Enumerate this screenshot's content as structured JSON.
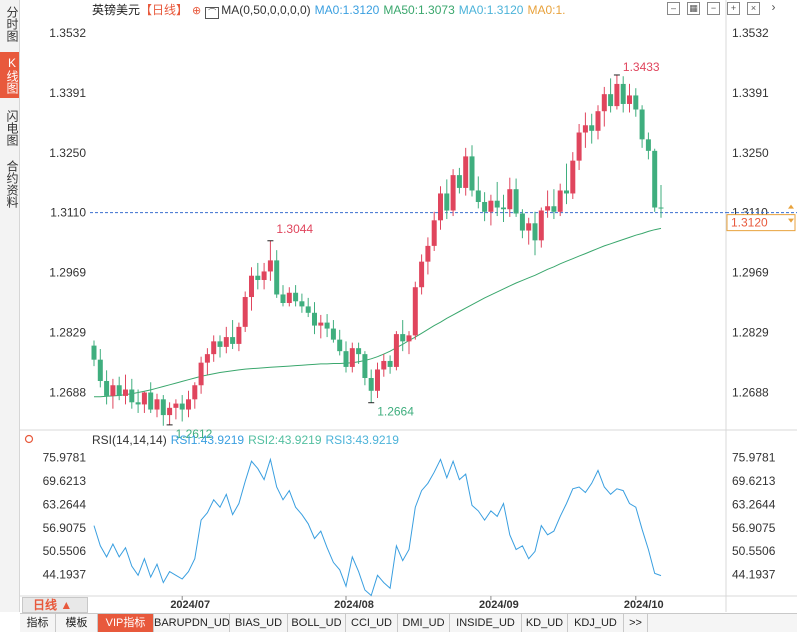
{
  "sidebar": {
    "tabs": [
      {
        "label": "分时图",
        "active": false
      },
      {
        "label": "K线图",
        "active": true
      },
      {
        "label": "闪电图",
        "active": false
      },
      {
        "label": "合约资料",
        "active": false
      }
    ]
  },
  "header": {
    "symbol": "英镑美元",
    "period": "【日线】",
    "ma_label": "MA(0,50,0,0,0,0)",
    "ma_values": [
      "MA0:1.3120",
      "MA50:1.3073",
      "MA0:1.3120",
      "MA0:1."
    ]
  },
  "rsi_header": {
    "label": "RSI(14,14,14)",
    "values": [
      "RSI1:43.9219",
      "RSI2:43.9219",
      "RSI3:43.9219"
    ]
  },
  "price_panel": {
    "current_price": "1.3120",
    "current_price_partial": "1.3110",
    "high_annotation": "1.3433",
    "mid_high_annotation": "1.3044",
    "low_annotation_1": "1.2612",
    "low_annotation_2": "1.2664"
  },
  "bottom": {
    "period_button": "日线 ▲",
    "tabs": [
      "指标",
      "模板",
      "VIP指标",
      "BARUPDN_UD",
      "BIAS_UD",
      "BOLL_UD",
      "CCI_UD",
      "DMI_UD",
      "INSIDE_UD",
      "KD_UD",
      "KDJ_UD",
      ">>"
    ]
  },
  "colors": {
    "up": "#e0455d",
    "down": "#3fae7e",
    "ma50": "#3aa76d",
    "rsi": "#3a9fe0",
    "current_line": "#3a6fcf",
    "accent": "#e8593c"
  },
  "chart_data": [
    {
      "type": "candlestick",
      "title": "英镑美元 日线",
      "x_ticks": [
        "2024/07",
        "2024/08",
        "2024/09",
        "2024/10"
      ],
      "y_ticks": [
        1.3532,
        1.3391,
        1.325,
        1.311,
        1.2969,
        1.2829,
        1.2688
      ],
      "y_tick_labels": [
        "1.3532",
        "1.3391",
        "1.3250",
        "1.3110",
        "1.2969",
        "1.2829",
        "1.2688"
      ],
      "ylim": [
        1.26,
        1.3562
      ],
      "grid": false,
      "candles": [
        [
          1.2798,
          1.281,
          1.275,
          1.2765
        ],
        [
          1.2765,
          1.279,
          1.27,
          1.2715
        ],
        [
          1.2715,
          1.274,
          1.266,
          1.268
        ],
        [
          1.268,
          1.272,
          1.265,
          1.2705
        ],
        [
          1.2705,
          1.2725,
          1.267,
          1.268
        ],
        [
          1.268,
          1.273,
          1.266,
          1.2695
        ],
        [
          1.2695,
          1.272,
          1.265,
          1.2665
        ],
        [
          1.2665,
          1.2695,
          1.264,
          1.266
        ],
        [
          1.266,
          1.269,
          1.264,
          1.2688
        ],
        [
          1.2688,
          1.2712,
          1.264,
          1.2648
        ],
        [
          1.2648,
          1.2685,
          1.263,
          1.2672
        ],
        [
          1.2672,
          1.2682,
          1.261,
          1.2635
        ],
        [
          1.2635,
          1.2665,
          1.2612,
          1.2652
        ],
        [
          1.2652,
          1.2672,
          1.2625,
          1.2662
        ],
        [
          1.2662,
          1.2682,
          1.262,
          1.2648
        ],
        [
          1.2648,
          1.2692,
          1.263,
          1.2672
        ],
        [
          1.2672,
          1.2712,
          1.265,
          1.2705
        ],
        [
          1.2705,
          1.2772,
          1.2685,
          1.2758
        ],
        [
          1.2758,
          1.2792,
          1.273,
          1.2778
        ],
        [
          1.2778,
          1.2822,
          1.276,
          1.2808
        ],
        [
          1.2808,
          1.2822,
          1.277,
          1.2795
        ],
        [
          1.2795,
          1.2842,
          1.278,
          1.2818
        ],
        [
          1.2818,
          1.2858,
          1.279,
          1.2802
        ],
        [
          1.2802,
          1.2852,
          1.2785,
          1.2842
        ],
        [
          1.2842,
          1.2925,
          1.283,
          1.2912
        ],
        [
          1.2912,
          1.2982,
          1.288,
          1.2962
        ],
        [
          1.2962,
          1.2992,
          1.293,
          1.2952
        ],
        [
          1.2952,
          1.2992,
          1.293,
          1.2972
        ],
        [
          1.2972,
          1.3044,
          1.295,
          1.2998
        ],
        [
          1.2998,
          1.3022,
          1.291,
          1.2918
        ],
        [
          1.2918,
          1.294,
          1.289,
          1.2898
        ],
        [
          1.2898,
          1.2935,
          1.289,
          1.2922
        ],
        [
          1.2922,
          1.294,
          1.289,
          1.2902
        ],
        [
          1.2902,
          1.292,
          1.2875,
          1.289
        ],
        [
          1.289,
          1.291,
          1.2865,
          1.2875
        ],
        [
          1.2875,
          1.29,
          1.2825,
          1.2845
        ],
        [
          1.2845,
          1.287,
          1.2815,
          1.2852
        ],
        [
          1.2852,
          1.2872,
          1.2818,
          1.2838
        ],
        [
          1.2838,
          1.2858,
          1.2805,
          1.2812
        ],
        [
          1.2812,
          1.2835,
          1.2775,
          1.2785
        ],
        [
          1.2785,
          1.2808,
          1.2735,
          1.2748
        ],
        [
          1.2748,
          1.2805,
          1.2735,
          1.2792
        ],
        [
          1.2792,
          1.2805,
          1.2755,
          1.2778
        ],
        [
          1.2778,
          1.2785,
          1.2705,
          1.2722
        ],
        [
          1.2722,
          1.2742,
          1.2664,
          1.2692
        ],
        [
          1.2692,
          1.2758,
          1.2675,
          1.2742
        ],
        [
          1.2742,
          1.2778,
          1.2725,
          1.2762
        ],
        [
          1.2762,
          1.2775,
          1.2732,
          1.2748
        ],
        [
          1.2748,
          1.2832,
          1.274,
          1.2825
        ],
        [
          1.2825,
          1.2858,
          1.2785,
          1.2808
        ],
        [
          1.2808,
          1.2832,
          1.2778,
          1.2822
        ],
        [
          1.2822,
          1.2948,
          1.2812,
          1.2935
        ],
        [
          1.2935,
          1.3012,
          1.2918,
          1.2995
        ],
        [
          1.2995,
          1.3052,
          1.2965,
          1.3032
        ],
        [
          1.3032,
          1.3112,
          1.302,
          1.3092
        ],
        [
          1.3092,
          1.3172,
          1.307,
          1.3155
        ],
        [
          1.3155,
          1.3188,
          1.3095,
          1.3115
        ],
        [
          1.3115,
          1.3212,
          1.3102,
          1.3198
        ],
        [
          1.3198,
          1.3215,
          1.3155,
          1.3168
        ],
        [
          1.3168,
          1.3262,
          1.315,
          1.3242
        ],
        [
          1.3242,
          1.3268,
          1.3148,
          1.3162
        ],
        [
          1.3162,
          1.3195,
          1.312,
          1.3135
        ],
        [
          1.3135,
          1.3158,
          1.309,
          1.3112
        ],
        [
          1.3112,
          1.3152,
          1.308,
          1.3138
        ],
        [
          1.3138,
          1.3182,
          1.3102,
          1.3122
        ],
        [
          1.3122,
          1.3152,
          1.3088,
          1.3118
        ],
        [
          1.3118,
          1.3192,
          1.31,
          1.3165
        ],
        [
          1.3165,
          1.319,
          1.31,
          1.3108
        ],
        [
          1.3108,
          1.3118,
          1.305,
          1.3068
        ],
        [
          1.3068,
          1.3098,
          1.3035,
          1.3085
        ],
        [
          1.3085,
          1.3112,
          1.301,
          1.3045
        ],
        [
          1.3045,
          1.3122,
          1.3028,
          1.3115
        ],
        [
          1.3115,
          1.3162,
          1.3098,
          1.3125
        ],
        [
          1.3125,
          1.3165,
          1.3095,
          1.3112
        ],
        [
          1.3112,
          1.3178,
          1.3102,
          1.3162
        ],
        [
          1.3162,
          1.3225,
          1.313,
          1.3155
        ],
        [
          1.3155,
          1.3252,
          1.3142,
          1.3232
        ],
        [
          1.3232,
          1.3318,
          1.321,
          1.3298
        ],
        [
          1.3298,
          1.3345,
          1.3262,
          1.3315
        ],
        [
          1.3315,
          1.3342,
          1.3272,
          1.3302
        ],
        [
          1.3302,
          1.3362,
          1.3282,
          1.3348
        ],
        [
          1.3348,
          1.3405,
          1.3312,
          1.3388
        ],
        [
          1.3388,
          1.3425,
          1.3345,
          1.336
        ],
        [
          1.336,
          1.3433,
          1.3352,
          1.3412
        ],
        [
          1.3412,
          1.343,
          1.3345,
          1.3365
        ],
        [
          1.3365,
          1.3412,
          1.3345,
          1.3385
        ],
        [
          1.3385,
          1.3402,
          1.3335,
          1.3352
        ],
        [
          1.3352,
          1.3362,
          1.3262,
          1.3282
        ],
        [
          1.3282,
          1.3298,
          1.3235,
          1.3255
        ],
        [
          1.3255,
          1.326,
          1.3112,
          1.3122
        ],
        [
          1.3122,
          1.3175,
          1.3098,
          1.312
        ]
      ],
      "ma50": [
        1.2678,
        1.2678,
        1.2679,
        1.268,
        1.2681,
        1.2683,
        1.2685,
        1.2688,
        1.2691,
        1.2694,
        1.2698,
        1.2702,
        1.2706,
        1.271,
        1.2714,
        1.2718,
        1.2722,
        1.2726,
        1.2729,
        1.2732,
        1.2735,
        1.2737,
        1.2739,
        1.2741,
        1.2743,
        1.2744,
        1.2745,
        1.2746,
        1.2747,
        1.2748,
        1.2749,
        1.275,
        1.2751,
        1.2752,
        1.2753,
        1.2754,
        1.2755,
        1.2755,
        1.2756,
        1.2756,
        1.2757,
        1.2758,
        1.276,
        1.2763,
        1.2767,
        1.2772,
        1.2778,
        1.2785,
        1.2793,
        1.2801,
        1.281,
        1.2818,
        1.2827,
        1.2836,
        1.2845,
        1.2853,
        1.2862,
        1.287,
        1.2878,
        1.2886,
        1.2894,
        1.2902,
        1.291,
        1.2917,
        1.2924,
        1.2931,
        1.2938,
        1.2945,
        1.2951,
        1.2957,
        1.2963,
        1.297,
        1.2977,
        1.2983,
        1.299,
        1.2996,
        1.3002,
        1.3008,
        1.3014,
        1.302,
        1.3026,
        1.3032,
        1.3037,
        1.3042,
        1.3047,
        1.3052,
        1.3057,
        1.3061,
        1.3066,
        1.307,
        1.3073
      ]
    },
    {
      "type": "line",
      "title": "RSI(14,14,14)",
      "y_ticks": [
        75.9781,
        69.6213,
        63.2644,
        56.9075,
        50.5506,
        44.1937
      ],
      "y_tick_labels": [
        "75.9781",
        "69.6213",
        "63.2644",
        "56.9075",
        "50.5506",
        "44.1937"
      ],
      "ylim": [
        40.0,
        77.5
      ],
      "series": [
        {
          "name": "RSI1",
          "values": [
            57.5,
            52.0,
            49.0,
            52.5,
            49.0,
            51.5,
            46.5,
            44.0,
            48.5,
            43.5,
            47.0,
            42.0,
            45.0,
            44.0,
            43.0,
            45.0,
            48.5,
            59.0,
            61.0,
            64.5,
            62.5,
            66.0,
            60.5,
            63.5,
            69.5,
            75.0,
            73.0,
            70.0,
            75.5,
            68.0,
            64.5,
            67.0,
            62.5,
            60.5,
            58.0,
            54.0,
            56.0,
            51.5,
            47.5,
            45.5,
            41.0,
            49.0,
            45.0,
            40.0,
            38.5,
            44.0,
            42.0,
            40.5,
            52.0,
            48.0,
            51.0,
            62.5,
            67.0,
            69.0,
            72.0,
            75.5,
            70.5,
            75.0,
            70.0,
            71.5,
            63.0,
            61.5,
            59.0,
            61.5,
            60.0,
            63.5,
            55.0,
            51.0,
            52.0,
            48.5,
            50.5,
            57.5,
            55.0,
            56.0,
            60.0,
            63.5,
            67.5,
            68.0,
            66.5,
            69.0,
            72.5,
            68.0,
            66.0,
            67.5,
            67.0,
            63.5,
            62.5,
            56.5,
            51.0,
            44.5,
            43.9219
          ]
        }
      ]
    }
  ]
}
